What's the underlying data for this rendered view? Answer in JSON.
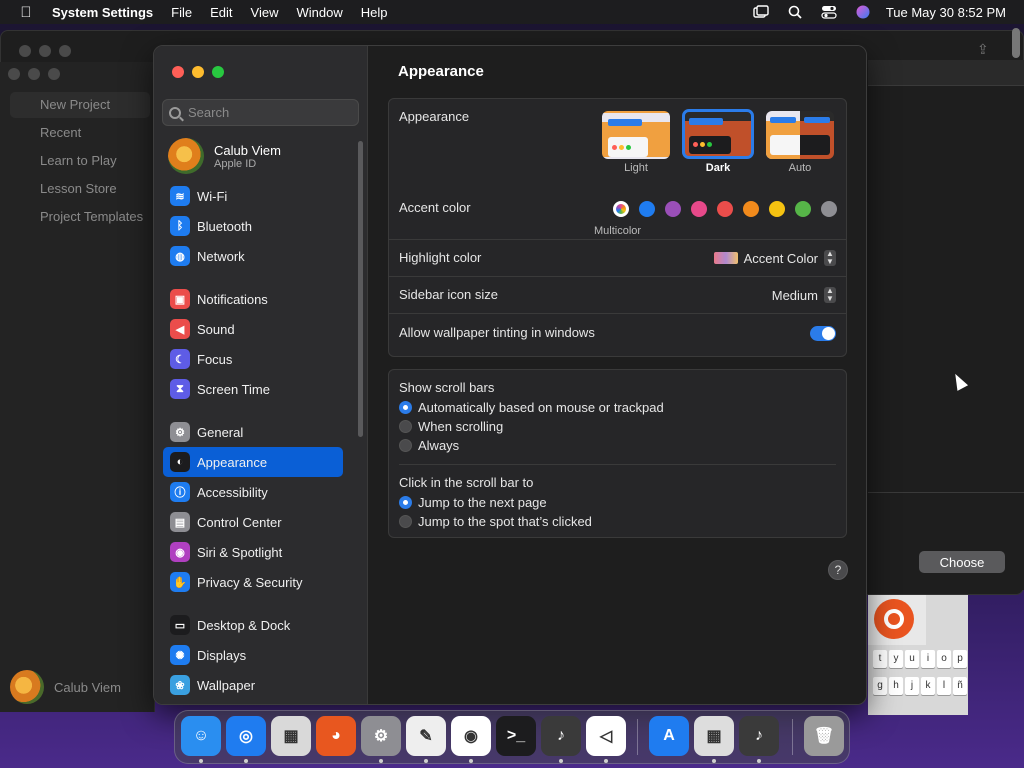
{
  "menubar": {
    "apple_glyph": "",
    "app_name": "System Settings",
    "menus": [
      "File",
      "Edit",
      "View",
      "Window",
      "Help"
    ],
    "clock": "Tue May 30  8:52 PM"
  },
  "background": {
    "nav_items": [
      "New Project",
      "Recent",
      "Learn to Play",
      "Lesson Store",
      "Project Templates"
    ],
    "user_name": "Calub Viem",
    "choose_label": "Choose",
    "keys": [
      "t",
      "y",
      "u",
      "i",
      "o",
      "p",
      "g",
      "h",
      "j",
      "k",
      "l",
      "ñ"
    ]
  },
  "sidebar": {
    "search_placeholder": "Search",
    "user": {
      "name": "Calub Viem",
      "subtitle": "Apple ID"
    },
    "items": [
      {
        "label": "Wi-Fi",
        "color": "#1e7cf0",
        "glyph": "≋"
      },
      {
        "label": "Bluetooth",
        "color": "#1e7cf0",
        "glyph": "ᛒ"
      },
      {
        "label": "Network",
        "color": "#1e7cf0",
        "glyph": "◍"
      },
      {
        "label": "Notifications",
        "color": "#eb4d4b",
        "glyph": "▣"
      },
      {
        "label": "Sound",
        "color": "#eb4d4b",
        "glyph": "◀"
      },
      {
        "label": "Focus",
        "color": "#5e5ce6",
        "glyph": "☾"
      },
      {
        "label": "Screen Time",
        "color": "#5e5ce6",
        "glyph": "⧗"
      },
      {
        "label": "General",
        "color": "#8e8e93",
        "glyph": "⚙"
      },
      {
        "label": "Appearance",
        "color": "#1c1c1e",
        "glyph": "◐"
      },
      {
        "label": "Accessibility",
        "color": "#1e7cf0",
        "glyph": "ⓘ"
      },
      {
        "label": "Control Center",
        "color": "#8e8e93",
        "glyph": "▤"
      },
      {
        "label": "Siri & Spotlight",
        "color": "#b040c0",
        "glyph": "◉"
      },
      {
        "label": "Privacy & Security",
        "color": "#1e7cf0",
        "glyph": "✋"
      },
      {
        "label": "Desktop & Dock",
        "color": "#1c1c1e",
        "glyph": "▭"
      },
      {
        "label": "Displays",
        "color": "#1e7cf0",
        "glyph": "✺"
      },
      {
        "label": "Wallpaper",
        "color": "#3aa0e0",
        "glyph": "❀"
      }
    ]
  },
  "content": {
    "title": "Appearance",
    "appearance_label": "Appearance",
    "themes": [
      {
        "label": "Light",
        "selected": false
      },
      {
        "label": "Dark",
        "selected": true
      },
      {
        "label": "Auto",
        "selected": false
      }
    ],
    "accent_label": "Accent color",
    "accent_colors": [
      "#ffffff",
      "#1f7cf0",
      "#9a4fb8",
      "#e7498a",
      "#eb4d4b",
      "#f18a1c",
      "#f5c211",
      "#56b548",
      "#8e8e93"
    ],
    "accent_caption": "Multicolor",
    "highlight_label": "Highlight color",
    "highlight_value": "Accent Color",
    "sidebar_icon_label": "Sidebar icon size",
    "sidebar_icon_value": "Medium",
    "tinting_label": "Allow wallpaper tinting in windows",
    "tinting_on": true,
    "scrollbars_label": "Show scroll bars",
    "scrollbar_options": [
      {
        "label": "Automatically based on mouse or trackpad",
        "selected": true
      },
      {
        "label": "When scrolling",
        "selected": false
      },
      {
        "label": "Always",
        "selected": false
      }
    ],
    "click_label": "Click in the scroll bar to",
    "click_options": [
      {
        "label": "Jump to the next page",
        "selected": true
      },
      {
        "label": "Jump to the spot that’s clicked",
        "selected": false
      }
    ],
    "help_glyph": "?"
  },
  "dock": {
    "apps": [
      {
        "name": "Finder",
        "color": "#2a8ef0"
      },
      {
        "name": "Safari",
        "color": "#1f7cf0"
      },
      {
        "name": "Launchpad",
        "color": "#d9d9d9"
      },
      {
        "name": "Firefox",
        "color": "#e8571f"
      },
      {
        "name": "System Settings",
        "color": "#8e8e93"
      },
      {
        "name": "TextEdit",
        "color": "#eeeeee"
      },
      {
        "name": "Chrome",
        "color": "#ffffff"
      },
      {
        "name": "Terminal",
        "color": "#1c1c1e"
      },
      {
        "name": "GarageBand",
        "color": "#3a3a3a"
      },
      {
        "name": "VS Code",
        "color": "#ffffff"
      },
      {
        "name": "App Store",
        "color": "#1f7cf0"
      },
      {
        "name": "Calculator",
        "color": "#dddddd"
      },
      {
        "name": "GarageBand 2",
        "color": "#3a3a3a"
      },
      {
        "name": "Trash",
        "color": "#9a9a9a"
      }
    ]
  }
}
